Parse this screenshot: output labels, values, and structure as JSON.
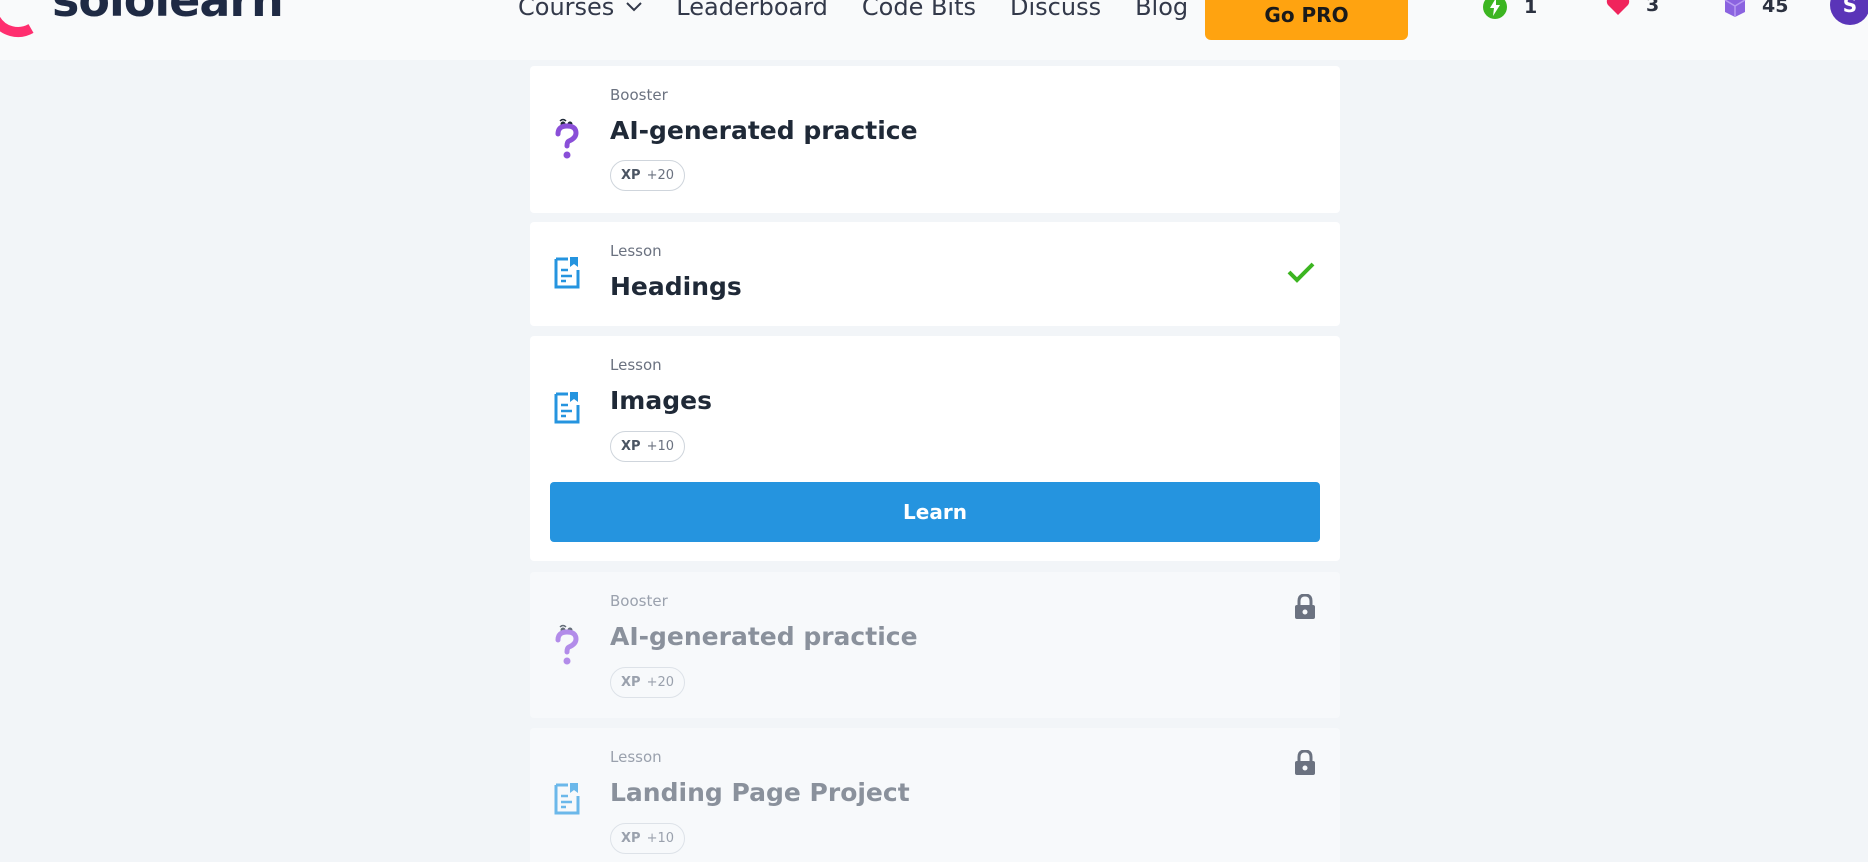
{
  "header": {
    "logo_text": "sololearn",
    "nav": [
      {
        "label": "Courses"
      },
      {
        "label": "Leaderboard"
      },
      {
        "label": "Code Bits"
      },
      {
        "label": "Discuss"
      },
      {
        "label": "Blog"
      }
    ],
    "go_pro_label": "Go PRO",
    "streak_count": "1",
    "hearts_count": "3",
    "bits_count": "45",
    "avatar_initial": "S"
  },
  "items": [
    {
      "kind": "Booster",
      "title": "AI-generated practice",
      "xp_label": "XP",
      "xp_value": "+20",
      "state": "available",
      "icon": "question-mark-icon"
    },
    {
      "kind": "Lesson",
      "title": "Headings",
      "state": "completed",
      "icon": "lesson-icon"
    },
    {
      "kind": "Lesson",
      "title": "Images",
      "xp_label": "XP",
      "xp_value": "+10",
      "state": "current",
      "icon": "lesson-icon",
      "button_label": "Learn"
    },
    {
      "kind": "Booster",
      "title": "AI-generated practice",
      "xp_label": "XP",
      "xp_value": "+20",
      "state": "locked",
      "icon": "question-mark-icon"
    },
    {
      "kind": "Lesson",
      "title": "Landing Page Project",
      "xp_label": "XP",
      "xp_value": "+10",
      "state": "locked",
      "icon": "lesson-icon"
    }
  ],
  "colors": {
    "accent_blue": "#2594df",
    "pro_orange": "#ffa310",
    "check_green": "#3cb521",
    "booster_purple": "#8a4fd8",
    "lesson_blue": "#2594df"
  }
}
